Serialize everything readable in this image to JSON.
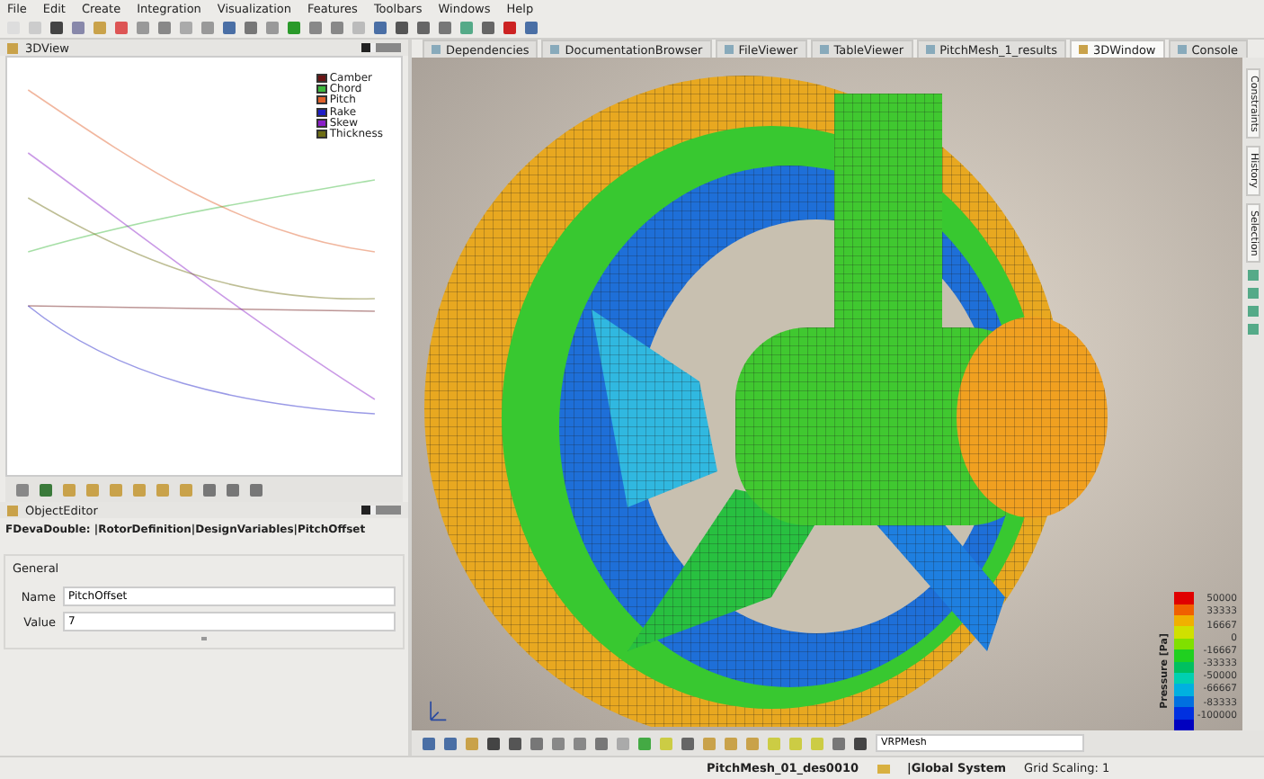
{
  "menu": [
    "File",
    "Edit",
    "Create",
    "Integration",
    "Visualization",
    "Features",
    "Toolbars",
    "Windows",
    "Help"
  ],
  "plot_panel": {
    "title": "3DView",
    "legend": [
      {
        "name": "Camber",
        "color": "#6b1414"
      },
      {
        "name": "Chord",
        "color": "#3cb83c"
      },
      {
        "name": "Pitch",
        "color": "#e0602a"
      },
      {
        "name": "Rake",
        "color": "#1e1ec8"
      },
      {
        "name": "Skew",
        "color": "#8a1ec8"
      },
      {
        "name": "Thickness",
        "color": "#6e6e14"
      }
    ]
  },
  "object_editor": {
    "title": "ObjectEditor",
    "path": "FDevaDouble: |RotorDefinition|DesignVariables|PitchOffset",
    "group": "General",
    "fields": [
      {
        "label": "Name",
        "value": "PitchOffset"
      },
      {
        "label": "Value",
        "value": "7"
      }
    ]
  },
  "tabs": [
    {
      "label": "Dependencies",
      "selected": false
    },
    {
      "label": "DocumentationBrowser",
      "selected": false
    },
    {
      "label": "FileViewer",
      "selected": false
    },
    {
      "label": "TableViewer",
      "selected": false
    },
    {
      "label": "PitchMesh_1_results",
      "selected": false
    },
    {
      "label": "3DWindow",
      "selected": true
    },
    {
      "label": "Console",
      "selected": false
    }
  ],
  "side_tabs": [
    "Constraints",
    "History",
    "Selection"
  ],
  "colorbar": {
    "title": "Pressure [Pa]",
    "labels": [
      "50000",
      "33333",
      "16667",
      "0",
      "-16667",
      "-33333",
      "-50000",
      "-66667",
      "-83333",
      "-100000"
    ]
  },
  "view_toolbar": {
    "mesh_field": "VRPMesh"
  },
  "status_bar": {
    "mesh": "PitchMesh_01_des0010",
    "system": "|Global System",
    "grid": "Grid Scaling: 1"
  }
}
